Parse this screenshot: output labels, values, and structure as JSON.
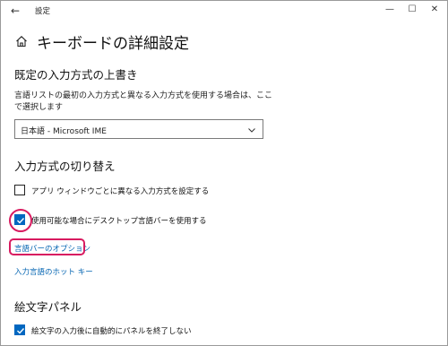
{
  "window": {
    "title": "設定",
    "back_glyph": "←",
    "min_glyph": "—",
    "max_glyph": "☐",
    "close_glyph": "✕"
  },
  "page": {
    "title": "キーボードの詳細設定"
  },
  "override_section": {
    "heading": "既定の入力方式の上書き",
    "description": "言語リストの最初の入力方式と異なる入力方式を使用する場合は、ここで選択します",
    "dropdown_value": "日本語 - Microsoft IME"
  },
  "switch_section": {
    "heading": "入力方式の切り替え",
    "per_app_checkbox_label": "アプリ ウィンドウごとに異なる入力方式を設定する",
    "per_app_checked": false,
    "desktop_langbar_label": "使用可能な場合にデスクトップ言語バーを使用する",
    "desktop_langbar_checked": true,
    "langbar_options_link": "言語バーのオプション",
    "hotkeys_link": "入力言語のホット キー"
  },
  "emoji_section": {
    "heading": "絵文字パネル",
    "auto_close_label": "絵文字の入力後に自動的にパネルを終了しない",
    "auto_close_checked": true
  },
  "colors": {
    "accent": "#0067c0",
    "link": "#0063b1",
    "highlight": "#d81b60"
  }
}
